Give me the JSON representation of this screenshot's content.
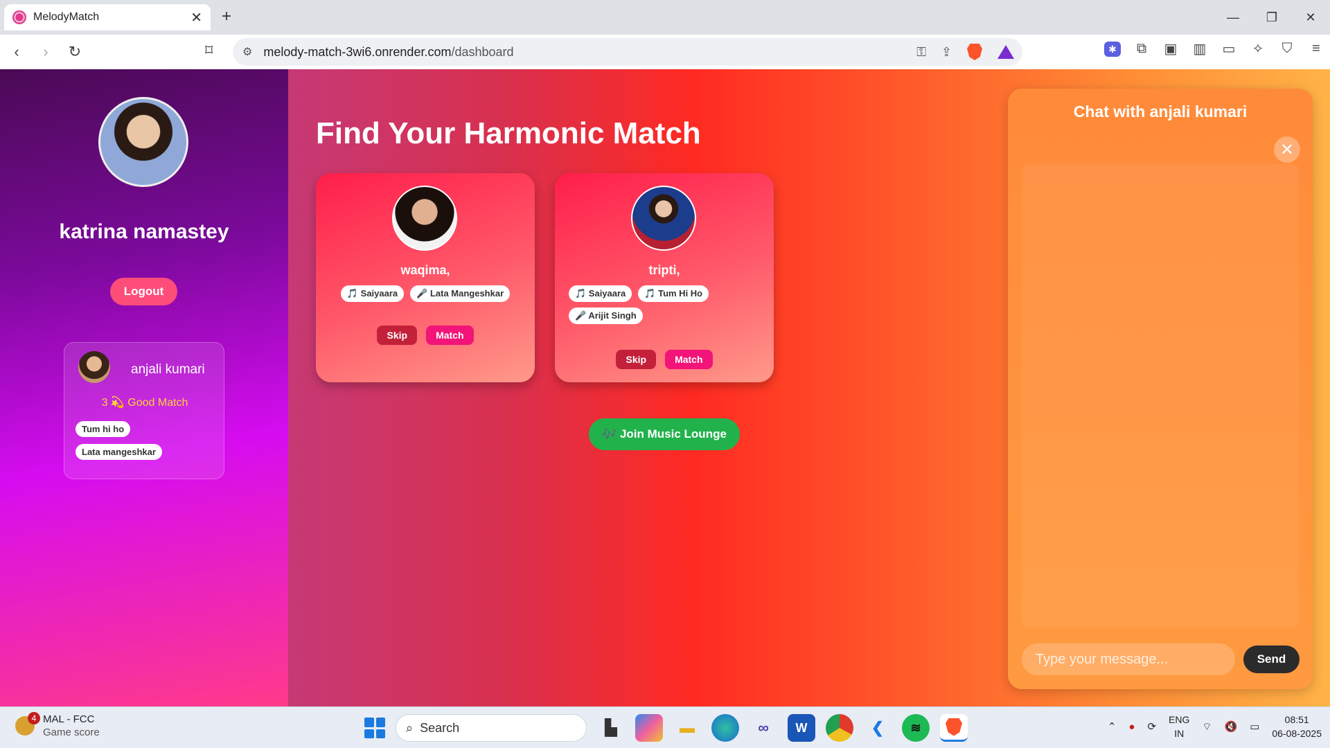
{
  "browser": {
    "tab_title": "MelodyMatch",
    "url_host": "melody-match-3wi6.onrender.com",
    "url_path": "/dashboard"
  },
  "sidebar": {
    "user_name": "katrina namastey",
    "logout_label": "Logout",
    "match": {
      "name": "anjali kumari",
      "score": "3 💫 Good Match",
      "tags": [
        "Tum hi ho",
        "Lata mangeshkar"
      ]
    }
  },
  "main": {
    "heading": "Find Your Harmonic Match",
    "cards": [
      {
        "name": "waqima,",
        "song": "🎵 Saiyaara",
        "artist": "🎤 Lata Mangeshkar",
        "skip": "Skip",
        "match": "Match"
      },
      {
        "name": "tripti,",
        "song1": "🎵 Saiyaara",
        "song2": "🎵 Tum Hi Ho",
        "artist": "🎤 Arijit Singh",
        "skip": "Skip",
        "match": "Match"
      }
    ],
    "lounge_label": "🎶 Join Music Lounge"
  },
  "chat": {
    "title": "Chat with anjali kumari",
    "placeholder": "Type your message...",
    "send_label": "Send"
  },
  "taskbar": {
    "widget_title": "MAL - FCC",
    "widget_sub": "Game score",
    "widget_badge": "4",
    "search_label": "Search",
    "lang_1": "ENG",
    "lang_2": "IN",
    "time": "08:51",
    "date": "06-08-2025"
  }
}
